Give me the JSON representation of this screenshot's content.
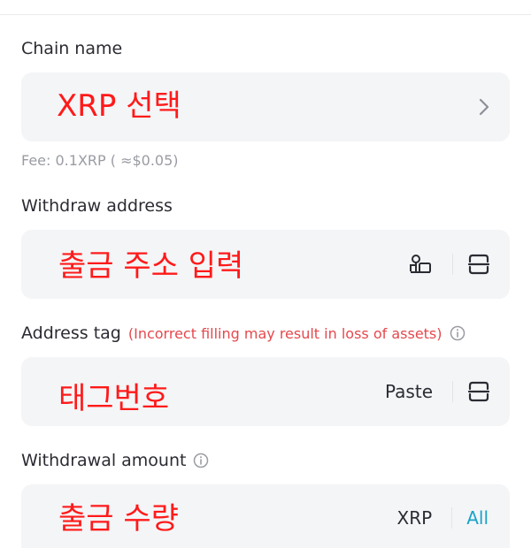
{
  "chain": {
    "label": "Chain name",
    "overlay": "XRP 선택",
    "fee": "Fee: 0.1XRP ( ≈$0.05)"
  },
  "withdraw": {
    "label": "Withdraw address",
    "overlay": "출금 주소 입력"
  },
  "tag": {
    "label": "Address tag",
    "warning": "(Incorrect filling may result in loss of assets)",
    "overlay": "태그번호",
    "paste_label": "Paste"
  },
  "amount": {
    "label": "Withdrawal amount",
    "overlay": "출금 수량",
    "unit": "XRP",
    "all_label": "All"
  },
  "icons": {
    "chevron": "chevron-right-icon",
    "address_book": "address-book-icon",
    "scan": "scan-icon",
    "info": "info-icon"
  },
  "colors": {
    "accent": "#1aa3c8",
    "warning": "#e5484d",
    "overlay_red": "#ff1a1a",
    "field_bg": "#f4f5f7"
  }
}
